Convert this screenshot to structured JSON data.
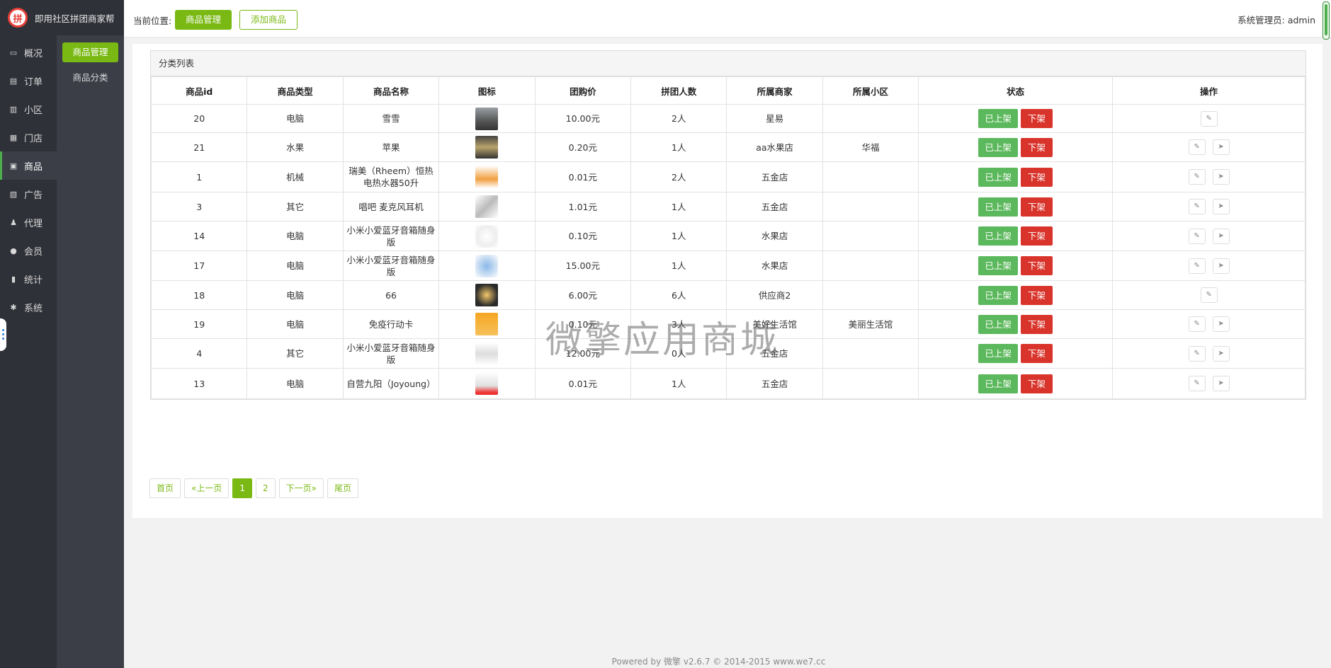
{
  "brand": {
    "title": "即用社区拼团商家帮",
    "logo_text": "拼"
  },
  "nav": [
    {
      "label": "概况",
      "icon": "monitor-icon"
    },
    {
      "label": "订单",
      "icon": "file-icon"
    },
    {
      "label": "小区",
      "icon": "building-icon"
    },
    {
      "label": "门店",
      "icon": "store-icon"
    },
    {
      "label": "商品",
      "icon": "image-icon"
    },
    {
      "label": "广告",
      "icon": "ad-icon"
    },
    {
      "label": "代理",
      "icon": "agent-icon"
    },
    {
      "label": "会员",
      "icon": "user-icon"
    },
    {
      "label": "统计",
      "icon": "bar-chart-icon"
    },
    {
      "label": "系统",
      "icon": "gear-icon"
    }
  ],
  "subnav": [
    {
      "label": "商品管理"
    },
    {
      "label": "商品分类"
    }
  ],
  "topbar": {
    "crumb_label": "当前位置:",
    "current_button": "商品管理",
    "add_button": "添加商品",
    "admin_text": "系统管理员: admin"
  },
  "panel": {
    "title": "分类列表"
  },
  "table": {
    "headers": [
      "商品id",
      "商品类型",
      "商品名称",
      "图标",
      "团购价",
      "拼团人数",
      "所属商家",
      "所属小区",
      "状态",
      "操作"
    ],
    "rows": [
      {
        "id": "20",
        "type": "电脑",
        "name": "雪雪",
        "price": "10.00元",
        "people": "2人",
        "merchant": "星易",
        "community": "",
        "on": "已上架",
        "off": "下架",
        "ops": 1
      },
      {
        "id": "21",
        "type": "水果",
        "name": "苹果",
        "price": "0.20元",
        "people": "1人",
        "merchant": "aa水果店",
        "community": "华福",
        "on": "已上架",
        "off": "下架",
        "ops": 2
      },
      {
        "id": "1",
        "type": "机械",
        "name": "瑞美（Rheem）恒热电热水器50升",
        "price": "0.01元",
        "people": "2人",
        "merchant": "五金店",
        "community": "",
        "on": "已上架",
        "off": "下架",
        "ops": 2
      },
      {
        "id": "3",
        "type": "其它",
        "name": "唱吧 麦克风耳机",
        "price": "1.01元",
        "people": "1人",
        "merchant": "五金店",
        "community": "",
        "on": "已上架",
        "off": "下架",
        "ops": 2
      },
      {
        "id": "14",
        "type": "电脑",
        "name": "小米小爱蓝牙音箱随身版",
        "price": "0.10元",
        "people": "1人",
        "merchant": "水果店",
        "community": "",
        "on": "已上架",
        "off": "下架",
        "ops": 2
      },
      {
        "id": "17",
        "type": "电脑",
        "name": "小米小爱蓝牙音箱随身版",
        "price": "15.00元",
        "people": "1人",
        "merchant": "水果店",
        "community": "",
        "on": "已上架",
        "off": "下架",
        "ops": 2
      },
      {
        "id": "18",
        "type": "电脑",
        "name": "66",
        "price": "6.00元",
        "people": "6人",
        "merchant": "供应商2",
        "community": "",
        "on": "已上架",
        "off": "下架",
        "ops": 1
      },
      {
        "id": "19",
        "type": "电脑",
        "name": "免疫行动卡",
        "price": "0.10元",
        "people": "3人",
        "merchant": "美好生活馆",
        "community": "美丽生活馆",
        "on": "已上架",
        "off": "下架",
        "ops": 2
      },
      {
        "id": "4",
        "type": "其它",
        "name": "小米小爱蓝牙音箱随身版",
        "price": "12.00元",
        "people": "0人",
        "merchant": "五金店",
        "community": "",
        "on": "已上架",
        "off": "下架",
        "ops": 2
      },
      {
        "id": "13",
        "type": "电脑",
        "name": "自营九阳（Joyoung）",
        "price": "0.01元",
        "people": "1人",
        "merchant": "五金店",
        "community": "",
        "on": "已上架",
        "off": "下架",
        "ops": 2
      }
    ]
  },
  "pagination": [
    "首页",
    "«上一页",
    "1",
    "2",
    "下一页»",
    "尾页"
  ],
  "pagination_active": "1",
  "watermark": "微擎应用商城",
  "footer": "Powered by 微擎 v2.6.7 © 2014-2015 www.we7.cc",
  "colors": {
    "accent": "#7ab914",
    "on": "#5cb85c",
    "off": "#d9342b",
    "sidebar": "#2f3138"
  }
}
